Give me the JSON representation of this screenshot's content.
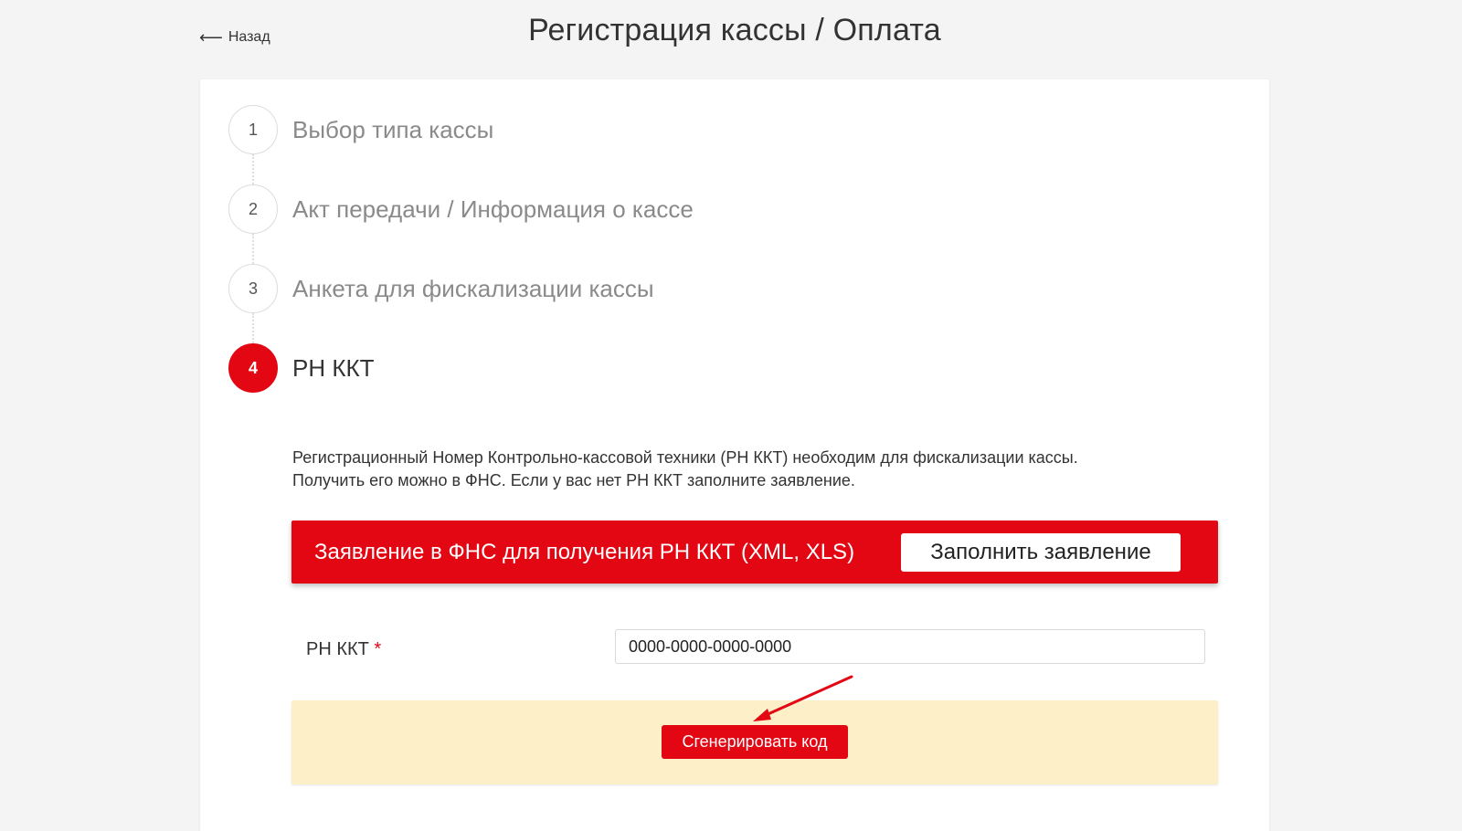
{
  "header": {
    "back_label": "Назад",
    "title": "Регистрация кассы / Оплата"
  },
  "steps": [
    {
      "number": "1",
      "label": "Выбор типа кассы",
      "active": false
    },
    {
      "number": "2",
      "label": "Акт передачи / Информация о кассе",
      "active": false
    },
    {
      "number": "3",
      "label": "Анкета для фискализации кассы",
      "active": false
    },
    {
      "number": "4",
      "label": "РН ККТ",
      "active": true
    }
  ],
  "step4": {
    "description_line1": "Регистрационный Номер Контрольно-кассовой техники (РН ККТ) необходим для фискализации кассы.",
    "description_line2": "Получить его можно в ФНС. Если у вас нет РН ККТ заполните заявление.",
    "banner_text": "Заявление в ФНС для получения РН ККТ (XML, XLS)",
    "fill_button_label": "Заполнить заявление",
    "rn_label": "РН ККТ",
    "required_mark": "*",
    "rn_value": "0000-0000-0000-0000",
    "generate_button_label": "Сгенерировать код"
  },
  "colors": {
    "accent": "#e30613",
    "panel": "#fdf0c8",
    "background": "#f4f4f4"
  },
  "icons": {
    "back": "arrow-left-icon",
    "annotation": "red-arrow-annotation"
  }
}
